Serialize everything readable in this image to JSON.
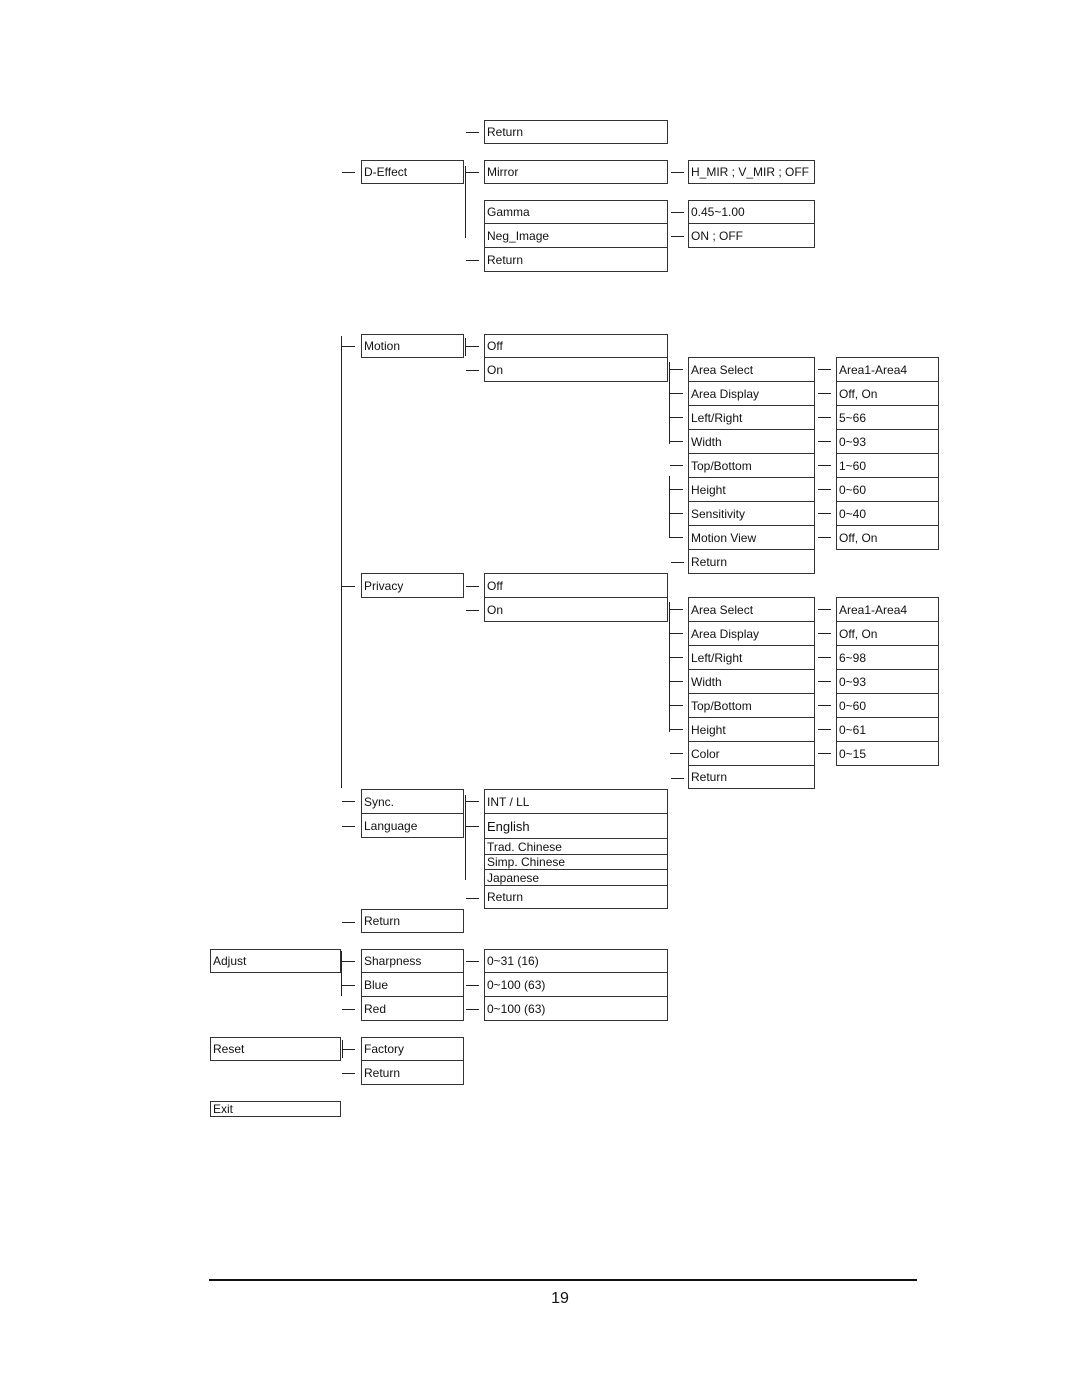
{
  "document": {
    "page_number": "19"
  },
  "menu": {
    "deffect": {
      "label": "D-Effect",
      "return_top": "Return",
      "items": [
        {
          "label": "Mirror",
          "value": "H_MIR ; V_MIR ; OFF"
        },
        {
          "label": "Gamma",
          "value": "0.45~1.00"
        },
        {
          "label": "Neg_Image",
          "value": "ON ; OFF"
        }
      ],
      "return_bottom": "Return"
    },
    "motion": {
      "label": "Motion",
      "options": [
        "Off",
        "On"
      ],
      "settings": [
        {
          "label": "Area Select",
          "value": "Area1-Area4"
        },
        {
          "label": "Area Display",
          "value": "Off, On"
        },
        {
          "label": "Left/Right",
          "value": "5~66"
        },
        {
          "label": "Width",
          "value": "0~93"
        },
        {
          "label": "Top/Bottom",
          "value": "1~60"
        },
        {
          "label": "Height",
          "value": "0~60"
        },
        {
          "label": "Sensitivity",
          "value": "0~40"
        },
        {
          "label": "Motion View",
          "value": "Off, On"
        }
      ],
      "return": "Return"
    },
    "privacy": {
      "label": "Privacy",
      "options": [
        "Off",
        "On"
      ],
      "settings": [
        {
          "label": "Area Select",
          "value": "Area1-Area4"
        },
        {
          "label": "Area Display",
          "value": "Off, On"
        },
        {
          "label": "Left/Right",
          "value": "6~98"
        },
        {
          "label": "Width",
          "value": "0~93"
        },
        {
          "label": "Top/Bottom",
          "value": "0~60"
        },
        {
          "label": "Height",
          "value": "0~61"
        },
        {
          "label": "Color",
          "value": "0~15"
        }
      ],
      "return": "Return"
    },
    "sync": {
      "label": "Sync.",
      "value": "INT /  LL"
    },
    "language": {
      "label": "Language",
      "options": [
        "English",
        "Trad. Chinese",
        "Simp. Chinese",
        "Japanese"
      ],
      "return": "Return"
    },
    "setup_return": "Return",
    "adjust": {
      "label": "Adjust",
      "items": [
        {
          "label": "Sharpness",
          "value": "0~31  (16)"
        },
        {
          "label": "Blue",
          "value": "0~100  (63)"
        },
        {
          "label": "Red",
          "value": "0~100 (63)"
        }
      ]
    },
    "reset": {
      "label": "Reset",
      "items": [
        "Factory",
        "Return"
      ]
    },
    "exit": {
      "label": "Exit"
    }
  }
}
